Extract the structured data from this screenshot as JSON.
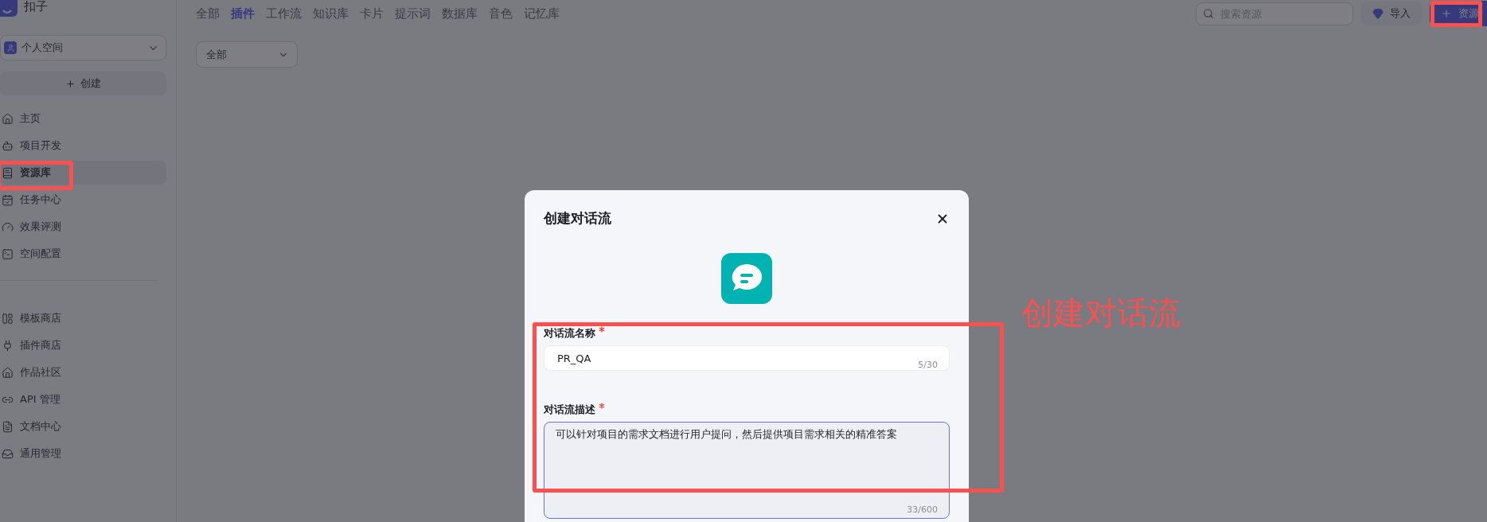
{
  "app": {
    "name": "扣子"
  },
  "space": {
    "label": "个人空间"
  },
  "create_button": "创建",
  "nav_primary": [
    {
      "label": "主页",
      "selected": false
    },
    {
      "label": "项目开发",
      "selected": false
    },
    {
      "label": "资源库",
      "selected": true
    },
    {
      "label": "任务中心",
      "selected": false
    },
    {
      "label": "效果评测",
      "selected": false
    },
    {
      "label": "空间配置",
      "selected": false
    }
  ],
  "nav_secondary": [
    {
      "label": "模板商店",
      "selected": false
    },
    {
      "label": "插件商店",
      "selected": false
    },
    {
      "label": "作品社区",
      "selected": false
    },
    {
      "label": "API 管理",
      "selected": false
    },
    {
      "label": "文档中心",
      "selected": false
    },
    {
      "label": "通用管理",
      "selected": false
    }
  ],
  "tabs": [
    {
      "label": "全部",
      "selected": false
    },
    {
      "label": "插件",
      "selected": true
    },
    {
      "label": "工作流",
      "selected": false
    },
    {
      "label": "知识库",
      "selected": false
    },
    {
      "label": "卡片",
      "selected": false
    },
    {
      "label": "提示词",
      "selected": false
    },
    {
      "label": "数据库",
      "selected": false
    },
    {
      "label": "音色",
      "selected": false
    },
    {
      "label": "记忆库",
      "selected": false
    }
  ],
  "filter": {
    "value": "全部"
  },
  "search": {
    "placeholder": "搜索资源"
  },
  "import_button": "导入",
  "add_button": "资源",
  "dialog": {
    "title": "创建对话流",
    "fields": [
      {
        "kind": "input",
        "label": "对话流名称",
        "required": true,
        "value": "PR_QA",
        "counter": "5/30",
        "focused": false
      },
      {
        "kind": "textarea",
        "label": "对话流描述",
        "required": true,
        "value": "可以针对项目的需求文档进行用户提问，然后提供项目需求相关的精准答案",
        "counter": "33/600",
        "focused": true
      }
    ]
  },
  "annotation": {
    "text": "创建对话流"
  }
}
